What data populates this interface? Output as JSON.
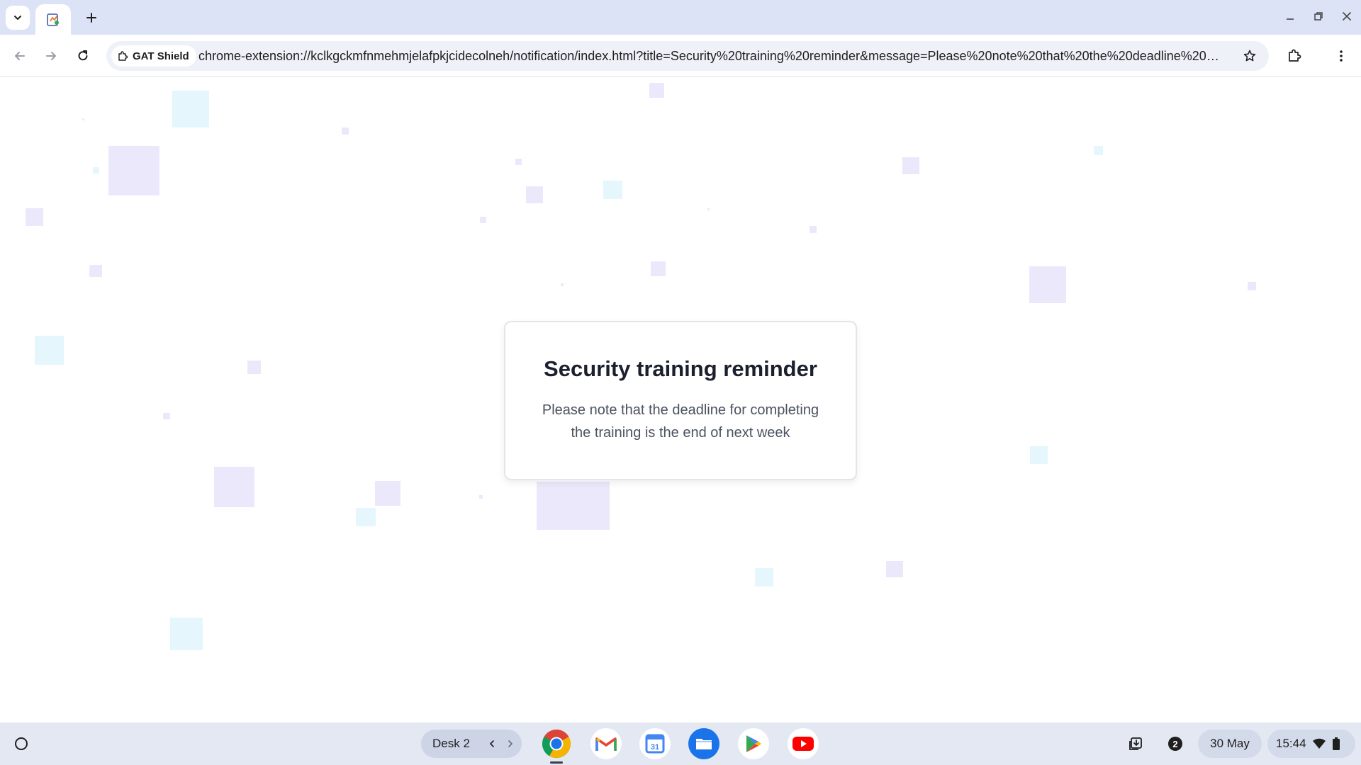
{
  "browser": {
    "tab": {
      "icon": "extension-notification-icon"
    },
    "omnibox": {
      "site_chip_label": "GAT Shield",
      "url": "chrome-extension://kclkgckmfnmehmjelafpkjcidecolneh/notification/index.html?title=Security%20training%20reminder&message=Please%20note%20that%20the%20deadline%20for%20..."
    }
  },
  "notification": {
    "title": "Security training reminder",
    "message": "Please note that the deadline for completing the training is the end of next week"
  },
  "shelf": {
    "desk_label": "Desk 2",
    "apps": [
      "Chrome",
      "Gmail",
      "Calendar",
      "Files",
      "Play Store",
      "YouTube"
    ],
    "calendar_day": "31",
    "notification_count": "2",
    "date": "30 May",
    "time": "15:44"
  },
  "colors": {
    "accent": "#1a73e8",
    "tabstrip": "#dde3f7",
    "shelf": "#e3e8f3",
    "decor_purple": "#ece8fc",
    "decor_cyan": "#e5f6fd"
  }
}
